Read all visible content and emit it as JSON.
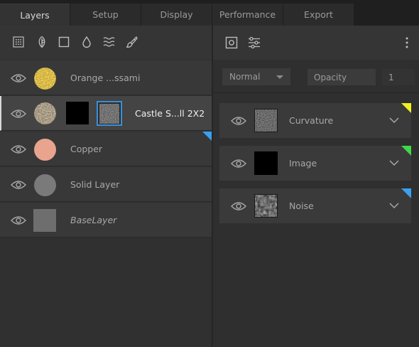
{
  "tabs": [
    {
      "label": "Layers",
      "active": true
    },
    {
      "label": "Setup",
      "active": false
    },
    {
      "label": "Display",
      "active": false
    },
    {
      "label": "Performance",
      "active": false
    },
    {
      "label": "Export",
      "active": false
    }
  ],
  "layer_toolbar": {
    "icons": [
      "grid-icon",
      "leaf-icon",
      "square-icon",
      "drop-icon",
      "waves-icon",
      "brush-icon"
    ]
  },
  "layers": [
    {
      "name": "Orange ...ssami",
      "thumb": "orange-texture",
      "selected": false
    },
    {
      "name": "Castle S...ll 2X2",
      "thumb": "stone-texture",
      "selected": true
    },
    {
      "name": "Copper",
      "thumb": "copper-circle",
      "selected": false,
      "corner_color": "#3aa0f0"
    },
    {
      "name": "Solid Layer",
      "thumb": "gray-circle",
      "selected": false
    },
    {
      "name": "BaseLayer",
      "thumb": "gray-square",
      "selected": false
    }
  ],
  "properties": {
    "blend_mode": "Normal",
    "opacity_label": "Opacity",
    "opacity_value": "1"
  },
  "effects": [
    {
      "name": "Curvature",
      "thumb": "noise-light",
      "corner_color": "#f0f020"
    },
    {
      "name": "Image",
      "thumb": "black",
      "corner_color": "#3ed84a"
    },
    {
      "name": "Noise",
      "thumb": "noise-dark",
      "corner_color": "#3aa0f0"
    }
  ],
  "colors": {
    "accent_selected_mask": "#3a8fd8",
    "copper": "#e8a48e",
    "solid_gray": "#7a7a7a"
  }
}
